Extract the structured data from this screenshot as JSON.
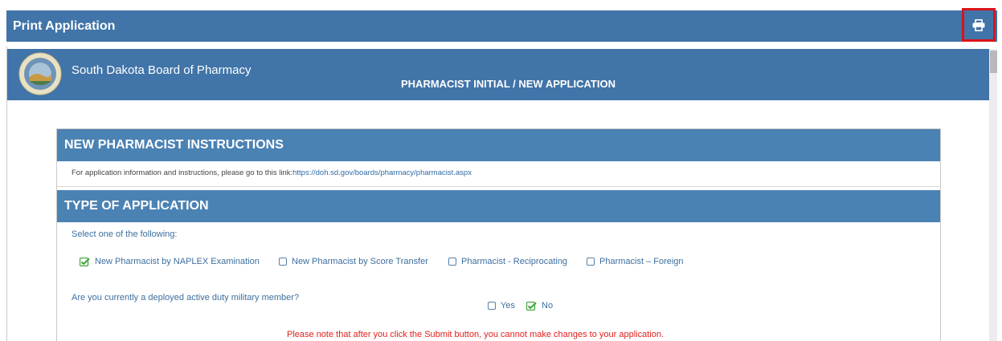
{
  "window": {
    "title": "Print Application",
    "print_icon": "printer-icon"
  },
  "board": {
    "name": "South Dakota Board of Pharmacy",
    "application_title": "PHARMACIST INITIAL / NEW APPLICATION",
    "seal_icon": "state-seal-icon"
  },
  "instructions": {
    "header": "NEW PHARMACIST INSTRUCTIONS",
    "text": "For application information and instructions, please go to this link:",
    "link": "https://doh.sd.gov/boards/pharmacy/pharmacist.aspx"
  },
  "type_of_application": {
    "header": "TYPE OF APPLICATION",
    "prompt": "Select one of the following:",
    "options": [
      {
        "label": "New Pharmacist by NAPLEX Examination",
        "checked": true
      },
      {
        "label": "New Pharmacist by Score Transfer",
        "checked": false
      },
      {
        "label": "Pharmacist - Reciprocating",
        "checked": false
      },
      {
        "label": "Pharmacist – Foreign",
        "checked": false
      }
    ],
    "military_question": "Are you currently a deployed active duty military member?",
    "military_options": [
      {
        "label": "Yes",
        "checked": false
      },
      {
        "label": "No",
        "checked": true
      }
    ]
  },
  "footer_note": "Please note that after you click the Submit button, you cannot make changes to your application.",
  "colors": {
    "header_blue": "#4174a8",
    "section_blue": "#4b82b4",
    "highlight_red": "#d9141b",
    "check_green": "#3aa335",
    "note_red": "#e0201e"
  }
}
